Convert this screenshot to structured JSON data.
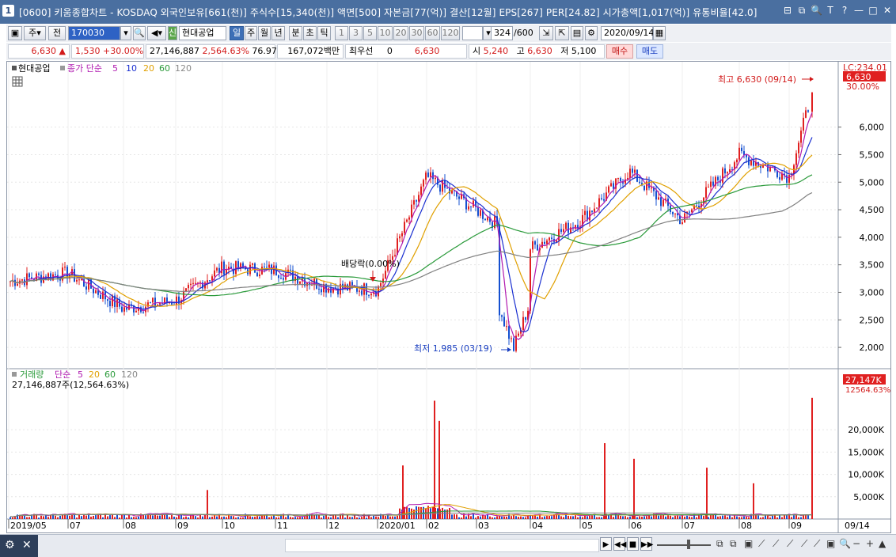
{
  "window": {
    "title": "[0600] 키움종합차트 - KOSDAQ 외국인보유[661(천)] 주식수[15,340(천)] 액면[500] 자본금[77(억)] 결산[12월] EPS[267] PER[24.82] 시가총액[1,017(억)] 유통비율[42.0]",
    "app_icon": "1",
    "controls": [
      "⊟",
      "⧉",
      "🔍",
      "T",
      "?",
      "—",
      "□",
      "✕"
    ]
  },
  "toolbar": {
    "period_main": "주",
    "prev": "전",
    "code": "170030",
    "stock_name_badge": "신",
    "stock_name": "현대공업",
    "periods": [
      "일",
      "주",
      "월",
      "년",
      "분",
      "초",
      "틱"
    ],
    "active_period": "일",
    "intervals": [
      "1",
      "3",
      "5",
      "10",
      "20",
      "30",
      "60",
      "120"
    ],
    "count": "324",
    "count_total": "/600",
    "date": "2020/09/14"
  },
  "quote": {
    "price": "6,630",
    "change": "1,530",
    "change_pct": "+30.00%",
    "volume": "27,146,887",
    "volume_pct": "2,564.63%",
    "ratio": "76.97%",
    "amount": "167,072백만",
    "best_label": "최우선",
    "best_value": "0",
    "ask": "6,630",
    "open_label": "시",
    "open": "5,240",
    "high_label": "고",
    "high": "6,630",
    "low_label": "저",
    "low": "5,100",
    "buy": "매수",
    "sell": "매도"
  },
  "price_panel": {
    "legend_stock": "현대공업",
    "legend_ma_label": "종가 단순",
    "legend_ma": [
      "5",
      "10",
      "20",
      "60",
      "120"
    ],
    "lc_label": "LC:234.01",
    "current_badge": "6,630",
    "pct_label": "30.00%",
    "high_annotation": "최고 6,630 (09/14)",
    "low_annotation": "최저 1,985 (03/19)",
    "dividend_annotation": "배당락(0.00%)"
  },
  "volume_panel": {
    "legend_label": "거래량",
    "legend_ma_label": "단순",
    "legend_ma": [
      "5",
      "20",
      "60",
      "120"
    ],
    "summary": "27,146,887주(12,564.63%)",
    "badge_volume": "27,147K",
    "badge_pct": "12564.63%"
  },
  "colors": {
    "up": "#e02020",
    "down": "#1550d0",
    "ma5": "#b01ab0",
    "ma10": "#1a2fd0",
    "ma20": "#e0a000",
    "ma60": "#2a9a3a",
    "ma120": "#808080",
    "title_bg": "#4a6fa0"
  },
  "chart_data": [
    {
      "type": "candlestick",
      "title": "현대공업",
      "x_ticks": [
        "2019/05",
        "07",
        "08",
        "09",
        "10",
        "11",
        "12",
        "2020/01",
        "02",
        "03",
        "04",
        "05",
        "06",
        "07",
        "08",
        "09",
        "09/14"
      ],
      "y_ticks": [
        "2,000",
        "2,500",
        "3,000",
        "3,500",
        "4,000",
        "4,500",
        "5,000",
        "5,500",
        "6,000"
      ],
      "ylim": [
        1800,
        6900
      ],
      "monthly_closes": [
        {
          "x": "2019/05",
          "y": 3200
        },
        {
          "x": "07",
          "y": 3350
        },
        {
          "x": "08",
          "y": 2700
        },
        {
          "x": "09",
          "y": 2850
        },
        {
          "x": "10",
          "y": 3450
        },
        {
          "x": "11",
          "y": 3400
        },
        {
          "x": "12",
          "y": 3100
        },
        {
          "x": "2020/01",
          "y": 3050
        },
        {
          "x": "02",
          "y": 5100
        },
        {
          "x": "03",
          "y": 4500
        },
        {
          "x": "04",
          "y": 3800
        },
        {
          "x": "05",
          "y": 4300
        },
        {
          "x": "06",
          "y": 5200
        },
        {
          "x": "07",
          "y": 4300
        },
        {
          "x": "08",
          "y": 5500
        },
        {
          "x": "09",
          "y": 5100
        },
        {
          "x": "09/14",
          "y": 6630
        }
      ],
      "high": {
        "date": "09/14",
        "value": 6630
      },
      "low": {
        "date": "03/19",
        "value": 1985
      }
    },
    {
      "type": "bar",
      "title": "거래량",
      "y_ticks": [
        "5,000K",
        "10,000K",
        "15,000K",
        "20,000K"
      ],
      "ylim": [
        0,
        28000
      ],
      "spikes": [
        {
          "x": "09",
          "y": 6500
        },
        {
          "x": "2020/01",
          "y": 12000
        },
        {
          "x": "02",
          "y": 26500
        },
        {
          "x": "02",
          "y": 22000
        },
        {
          "x": "05",
          "y": 17000
        },
        {
          "x": "06",
          "y": 13500
        },
        {
          "x": "07",
          "y": 11500
        },
        {
          "x": "08",
          "y": 8000
        },
        {
          "x": "09/14",
          "y": 27147
        }
      ]
    }
  ]
}
